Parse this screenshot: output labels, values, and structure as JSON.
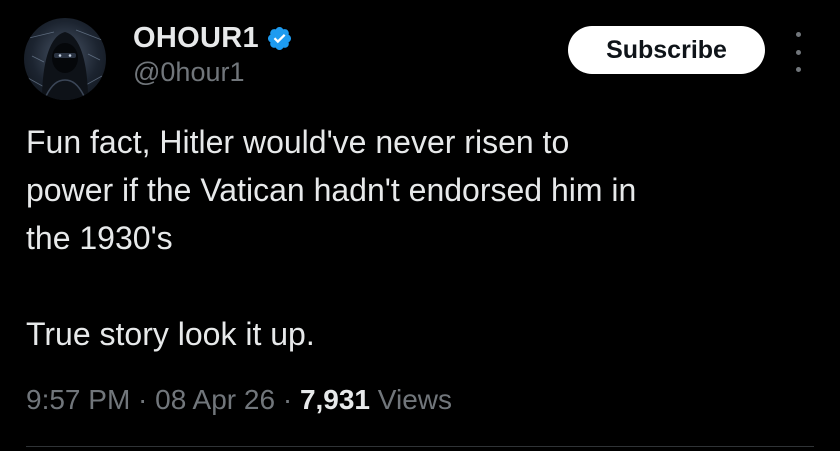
{
  "author": {
    "display_name": "OHOUR1",
    "handle": "@0hour1",
    "verified_icon": "verified-badge-icon",
    "verified_color": "#1d9bf0"
  },
  "actions": {
    "subscribe_label": "Subscribe",
    "more_icon": "vertical-ellipsis-icon"
  },
  "tweet": {
    "lines": [
      "Fun fact, Hitler would've never risen to",
      "power if the Vatican hadn't endorsed him in",
      "the 1930's"
    ],
    "second_paragraph": "True story look it up."
  },
  "meta": {
    "time": "9:57 PM",
    "separator": " · ",
    "date": "08 Apr 26",
    "views_count": "7,931",
    "views_label": "Views"
  },
  "colors": {
    "background": "#000000",
    "primary_text": "#e7e9ea",
    "secondary_text": "#71767b",
    "button_bg": "#ffffff",
    "button_text": "#0f1419"
  }
}
